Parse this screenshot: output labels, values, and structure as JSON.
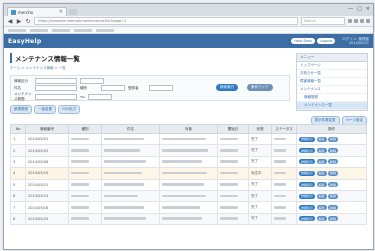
{
  "browser": {
    "tab_title": "mercho",
    "close_glyph": "×",
    "url_text": "https://example.internal/maintenance/list?page=1",
    "search_placeholder": "Search",
    "win_min": "—",
    "win_max": "□",
    "win_close": "×",
    "back_glyph": "◀",
    "forward_glyph": "▶",
    "reload_glyph": "↻"
  },
  "app": {
    "logo": "EasyHelp",
    "header_btn1": "Help Desk",
    "header_btn2": "Logout",
    "user_line1": "ログイン: 管理者",
    "user_line2": "2014/05/21"
  },
  "page": {
    "title": "メンテナンス情報一覧",
    "breadcrumb": "ホーム > メンテナンス情報 > 一覧"
  },
  "form": {
    "row1_label": "情報区分",
    "row2_label": "件名",
    "row2b_label": "種別",
    "row2c_label": "登録者",
    "row3_label": "メンテナンス期間",
    "row3_sep": "〜",
    "search_button": "検索実行",
    "clear_button": "条件クリア"
  },
  "actions": {
    "new": "新規登録",
    "bulk": "一括変更",
    "export": "CSV出力",
    "right1": "表示件数変更",
    "right2": "ページ設定"
  },
  "table": {
    "headers": [
      "No",
      "情報番号",
      "種別",
      "件名",
      "対象",
      "開始日",
      "状態",
      "ステータス",
      "操作"
    ],
    "rows": [
      {
        "no": "1",
        "id": "2014/05/01",
        "st": "完了"
      },
      {
        "no": "2",
        "id": "2014/05/03",
        "st": "完了"
      },
      {
        "no": "3",
        "id": "2014/05/08",
        "st": "完了"
      },
      {
        "no": "4",
        "id": "2014/05/10",
        "st": "対応中"
      },
      {
        "no": "5",
        "id": "2014/05/12",
        "st": "完了"
      },
      {
        "no": "6",
        "id": "2014/05/15",
        "st": "完了"
      },
      {
        "no": "7",
        "id": "2014/05/18",
        "st": "完了"
      },
      {
        "no": "8",
        "id": "2014/05/20",
        "st": "完了"
      }
    ],
    "row_btn1": "詳細表示",
    "row_btn2": "編集",
    "row_btn3": "削除"
  },
  "sidebar": {
    "header": "メニュー",
    "items": [
      "トップページ",
      "お知らせ一覧",
      "障害情報一覧",
      "メンテナンス",
      "情報登録",
      "メンテナンス一覧"
    ]
  }
}
